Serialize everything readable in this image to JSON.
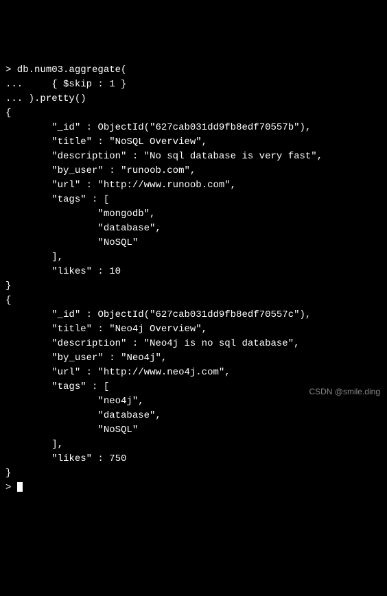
{
  "prompt": ">",
  "cont": "...",
  "command_line1": " db.num03.aggregate(",
  "command_line2": "     { $skip : 1 }",
  "command_line3": " ).pretty()",
  "docs": [
    {
      "id_label": "\"_id\"",
      "id_value": "ObjectId(\"627cab031dd9fb8edf70557b\"),",
      "title_label": "\"title\"",
      "title_value": "\"NoSQL Overview\",",
      "description_label": "\"description\"",
      "description_value": "\"No sql database is very fast\",",
      "by_user_label": "\"by_user\"",
      "by_user_value": "\"runoob.com\",",
      "url_label": "\"url\"",
      "url_value": "\"http://www.runoob.com\",",
      "tags_label": "\"tags\"",
      "tags": [
        "\"mongodb\",",
        "\"database\",",
        "\"NoSQL\""
      ],
      "likes_label": "\"likes\"",
      "likes_value": "10"
    },
    {
      "id_label": "\"_id\"",
      "id_value": "ObjectId(\"627cab031dd9fb8edf70557c\"),",
      "title_label": "\"title\"",
      "title_value": "\"Neo4j Overview\",",
      "description_label": "\"description\"",
      "description_value": "\"Neo4j is no sql database\",",
      "by_user_label": "\"by_user\"",
      "by_user_value": "\"Neo4j\",",
      "url_label": "\"url\"",
      "url_value": "\"http://www.neo4j.com\",",
      "tags_label": "\"tags\"",
      "tags": [
        "\"neo4j\",",
        "\"database\",",
        "\"NoSQL\""
      ],
      "likes_label": "\"likes\"",
      "likes_value": "750"
    }
  ],
  "watermark": "CSDN @smile.ding"
}
